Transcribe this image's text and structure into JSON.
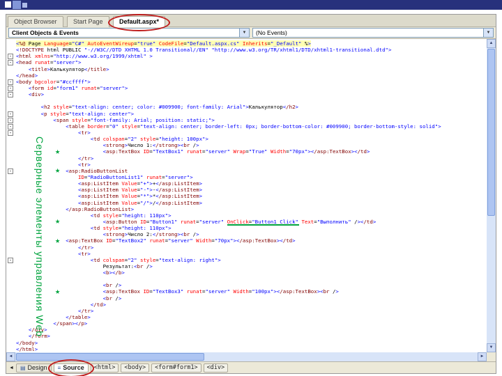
{
  "window": {
    "tabs": [
      {
        "label": "Object Browser"
      },
      {
        "label": "Start Page"
      },
      {
        "label": "Default.aspx*"
      }
    ],
    "combos": {
      "left": "Client Objects & Events",
      "right": "(No Events)"
    }
  },
  "editor": {
    "lines": [
      "<%@ Page Language=\"C#\" AutoEventWireup=\"true\" CodeFile=\"Default.aspx.cs\" Inherits=\"_Default\" %>",
      "<!DOCTYPE html PUBLIC \"-//W3C//DTD XHTML 1.0 Transitional//EN\" \"http://www.w3.org/TR/xhtml1/DTD/xhtml1-transitional.dtd\">",
      "<html xmlns=\"http://www.w3.org/1999/xhtml\" >",
      "<head runat=\"server\">",
      "    <title>Калькулятор</title>",
      "</head>",
      "<body bgcolor=\"#ccffff\">",
      "    <form id=\"form1\" runat=\"server\">",
      "    <div>",
      "",
      "        <h2 style=\"text-align: center; color: #009900; font-family: Arial\">Калькулятор</h2>",
      "        <p style=\"text-align: center\">",
      "            <span style=\"font-family: Arial; position: static;\">",
      "                <table border=\"0\" style=\"text-align: center; border-left: 0px; border-bottom-color: #009900; border-bottom-style: solid\">",
      "                    <tr>",
      "                        <td colspan=\"2\" style=\"height: 100px\">",
      "                            <strong>Число 1:</strong><br />",
      "                            <asp:TextBox ID=\"TextBox1\" runat=\"server\" Wrap=\"True\" Width=\"70px\"></asp:TextBox></td>",
      "                    </tr>",
      "                    <tr>",
      "                <asp:RadioButtonList",
      "                    ID=\"RadioButtonList1\" runat=\"server\">",
      "                    <asp:ListItem Value=\"+\">+</asp:ListItem>",
      "                    <asp:ListItem Value=\"-\">-</asp:ListItem>",
      "                    <asp:ListItem Value=\"*\">*</asp:ListItem>",
      "                    <asp:ListItem Value=\"/\">/</asp:ListItem>",
      "                </asp:RadioButtonList>",
      "                        <td style=\"height: 110px\">",
      "                            <asp:Button ID=\"Button1\" runat=\"server\" OnClick=\"Button1_Click\" Text=\"Выполнить\" /></td>",
      "                        <td style=\"height: 110px\">",
      "                            <strong>Число 2:</strong><br />",
      "                <asp:TextBox ID=\"TextBox2\" runat=\"server\" Width=\"70px\"></asp:TextBox></td>",
      "                    </tr>",
      "                    <tr>",
      "                        <td colspan=\"2\" style=\"text-align: right\">",
      "                            Результат:<br />",
      "                            <b></b>",
      "",
      "                            <br />",
      "                            <asp:TextBox ID=\"TextBox3\" runat=\"server\" Width=\"100px\"></asp:TextBox><br />",
      "                            <br />",
      "                        </td>",
      "                    </tr>",
      "                </table>",
      "            </span></p>",
      "    </div>",
      "    </form>",
      "</body>",
      "</html>"
    ],
    "fold_lines": [
      2,
      3,
      6,
      7,
      8,
      11,
      12,
      13,
      14,
      20,
      34
    ],
    "star_lines": [
      17,
      20,
      28,
      31,
      39
    ],
    "underline": {
      "line": 28,
      "text": "OnClick=\"Button1_Click\""
    }
  },
  "annotations": {
    "vertical_label": "Серверные элементы управления Web",
    "star_glyph": "★"
  },
  "icons": {
    "dropdown_arrow": "▼",
    "scroll_up": "▲",
    "scroll_down": "▼",
    "scroll_left": "◄",
    "scroll_right": "►",
    "back_arrow": "◄",
    "design_icon": "▤",
    "source_icon": "≡"
  },
  "bottom_bar": {
    "design_label": "Design",
    "source_label": "Source",
    "breadcrumbs": [
      "<html>",
      "<body>",
      "<form#form1>",
      "<div>"
    ]
  },
  "colors": {
    "tag_delim": "#0000ff",
    "tag_name": "#800000",
    "attr_name": "#ff0000",
    "attr_value": "#0000ff",
    "directive_bg": "#ffffb3",
    "annotation_green": "#00a33d",
    "annotation_red": "#bf1c1c"
  }
}
